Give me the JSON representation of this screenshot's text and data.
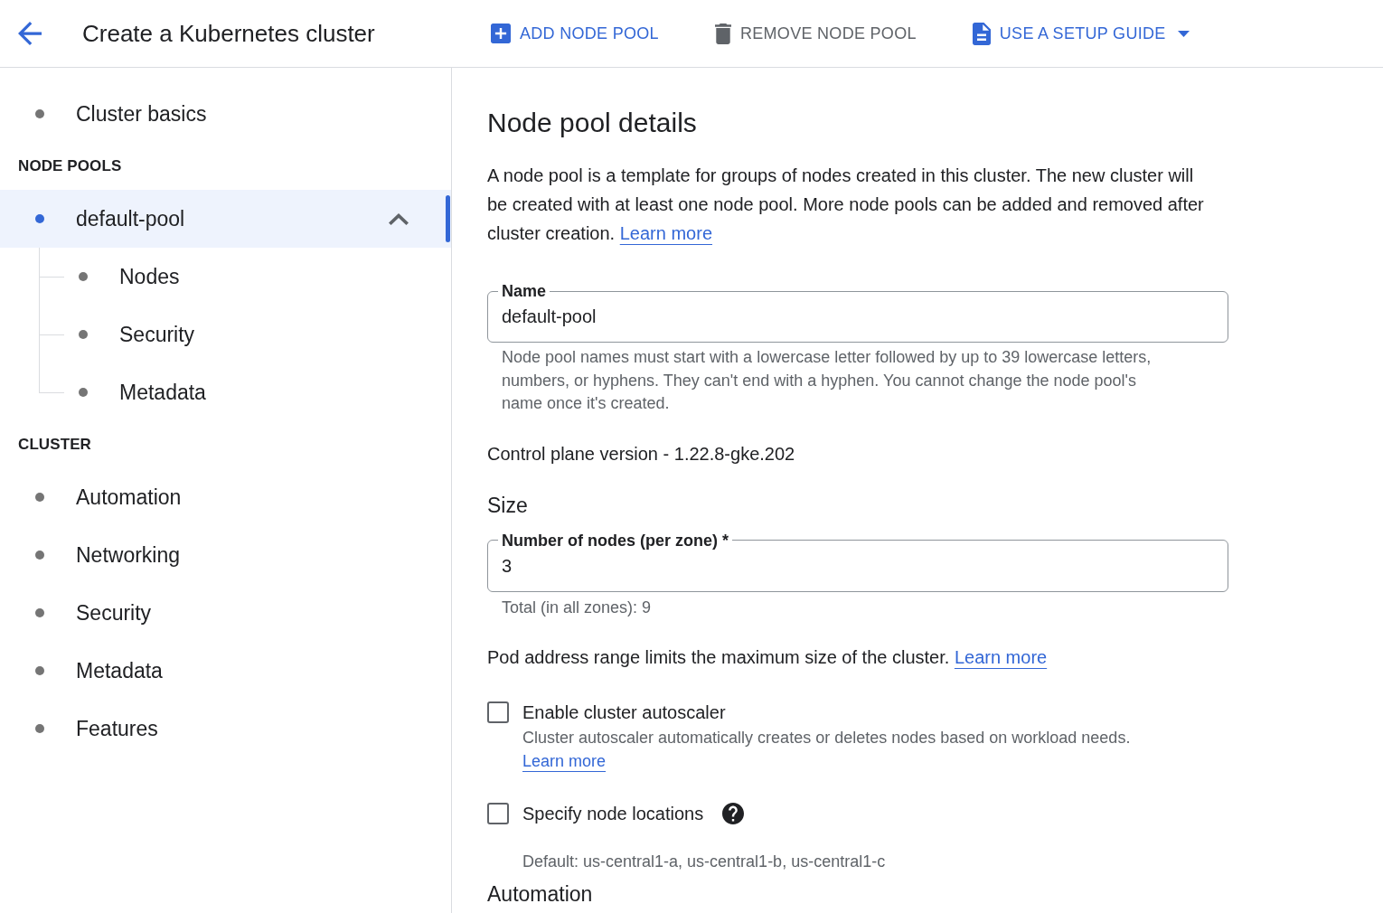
{
  "header": {
    "title": "Create a Kubernetes cluster",
    "actions": [
      {
        "label": "ADD NODE POOL",
        "kind": "add",
        "disabled": false,
        "dropdown": false
      },
      {
        "label": "REMOVE NODE POOL",
        "kind": "remove",
        "disabled": true,
        "dropdown": false
      },
      {
        "label": "USE A SETUP GUIDE",
        "kind": "guide",
        "disabled": false,
        "dropdown": true
      }
    ]
  },
  "sidebar": {
    "sections": [
      {
        "items": [
          {
            "label": "Cluster basics",
            "selected": false
          }
        ]
      },
      {
        "heading": "NODE POOLS",
        "items": [
          {
            "label": "default-pool",
            "selected": true,
            "expanded": true,
            "children": [
              {
                "label": "Nodes",
                "selected": false
              },
              {
                "label": "Security",
                "selected": false
              },
              {
                "label": "Metadata",
                "selected": false
              }
            ]
          }
        ]
      },
      {
        "heading": "CLUSTER",
        "items": [
          {
            "label": "Automation",
            "selected": false
          },
          {
            "label": "Networking",
            "selected": false
          },
          {
            "label": "Security",
            "selected": false
          },
          {
            "label": "Metadata",
            "selected": false
          },
          {
            "label": "Features",
            "selected": false
          }
        ]
      }
    ]
  },
  "main": {
    "title": "Node pool details",
    "intro": {
      "text": "A node pool is a template for groups of nodes created in this cluster. The new cluster will be created with at least one node pool. More node pools can be added and removed after cluster creation.",
      "link": "Learn more"
    },
    "name_field": {
      "label": "Name",
      "value": "default-pool",
      "hint": "Node pool names must start with a lowercase letter followed by up to 39 lowercase letters, numbers, or hyphens. They can't end with a hyphen. You cannot change the node pool's name once it's created."
    },
    "version": "Control plane version - 1.22.8-gke.202",
    "size": {
      "heading": "Size",
      "nodes_field": {
        "label": "Number of nodes (per zone) *",
        "value": "3",
        "hint": "Total (in all zones): 9"
      },
      "pod_range": {
        "text": "Pod address range limits the maximum size of the cluster.",
        "link": "Learn more"
      }
    },
    "options": [
      {
        "label": "Enable cluster autoscaler",
        "checked": false,
        "help": false,
        "description": "Cluster autoscaler automatically creates or deletes nodes based on workload needs.",
        "link": "Learn more"
      },
      {
        "label": "Specify node locations",
        "checked": false,
        "help": true,
        "note": "Default: us-central1-a, us-central1-b, us-central1-c"
      }
    ],
    "next_heading": "Automation"
  }
}
